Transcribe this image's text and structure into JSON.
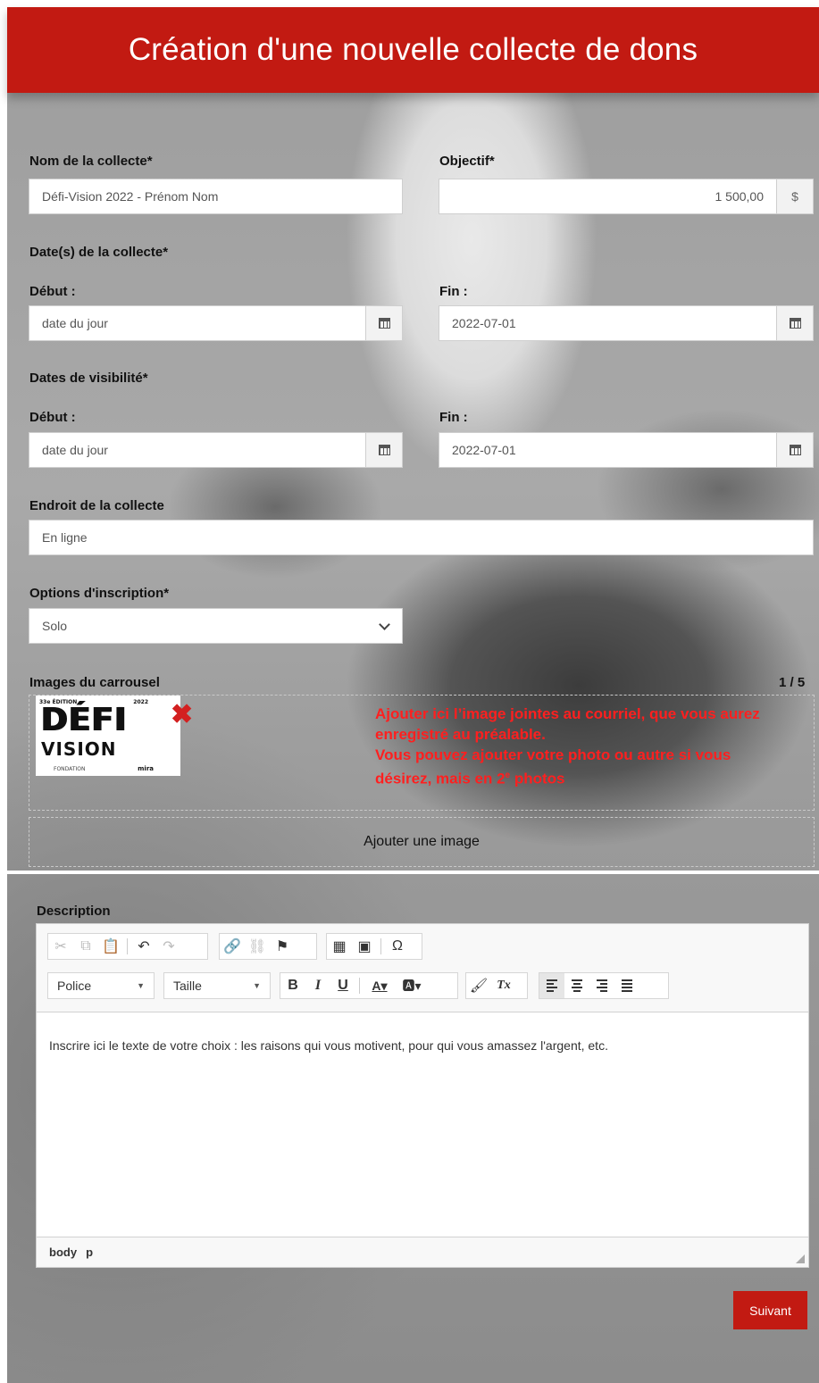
{
  "header": {
    "title": "Création d'une nouvelle collecte de dons"
  },
  "form": {
    "name": {
      "label": "Nom de la collecte*",
      "value": "Défi-Vision 2022 - Prénom Nom"
    },
    "goal": {
      "label": "Objectif*",
      "value": "1 500,00",
      "unit": "$"
    },
    "collect_dates": {
      "label": "Date(s) de la collecte*",
      "start_label": "Début :",
      "start_value": "date du jour",
      "end_label": "Fin :",
      "end_value": "2022-07-01"
    },
    "visibility_dates": {
      "label": "Dates de visibilité*",
      "start_label": "Début :",
      "start_value": "date du jour",
      "end_label": "Fin :",
      "end_value": "2022-07-01"
    },
    "location": {
      "label": "Endroit de la collecte",
      "value": "En ligne"
    },
    "registration": {
      "label": "Options d'inscription*",
      "selected": "Solo"
    },
    "carousel": {
      "label": "Images du carrousel",
      "count": "1 / 5",
      "logo": {
        "edition": "33e ÉDITION",
        "year": "2022",
        "line1": "DÉFI",
        "line2": "VISION",
        "brand": "mira",
        "small": "FONDATION"
      },
      "note_line1": "Ajouter ici l’image jointes au courriel, que vous aurez enregistré au préalable.",
      "note_line2a": "Vous pouvez ajouter votre photo ou autre si vous désirez, mais en 2",
      "note_sup": "e",
      "note_line2b": " photos",
      "add_label": "Ajouter une image"
    },
    "description": {
      "label": "Description",
      "font_label": "Police",
      "size_label": "Taille",
      "content": "Inscrire ici le texte de votre choix : les raisons qui vous motivent, pour qui vous amassez l'argent, etc.",
      "path_body": "body",
      "path_p": "p"
    }
  },
  "next_button": "Suivant",
  "colors": {
    "brand": "#c21a12",
    "note": "#ff1f1f"
  }
}
